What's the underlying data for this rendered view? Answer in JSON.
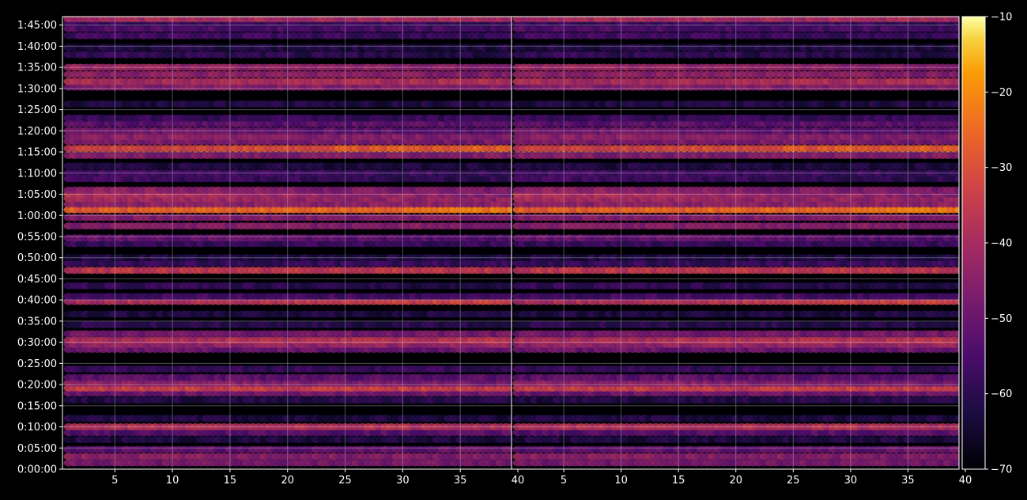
{
  "chart_data": {
    "type": "heatmap",
    "title": "",
    "xlabel": "",
    "ylabel": "",
    "grid": true,
    "panels": [
      {
        "name": "",
        "xlim": [
          1,
          40
        ],
        "xticks": [
          "5",
          "10",
          "15",
          "20",
          "25",
          "30",
          "35",
          "40"
        ],
        "ylim_seconds": [
          0,
          6420
        ]
      },
      {
        "name": "",
        "xlim": [
          1,
          40
        ],
        "xticks": [
          "5",
          "10",
          "15",
          "20",
          "25",
          "30",
          "35",
          "40"
        ],
        "ylim_seconds": [
          0,
          6420
        ]
      }
    ],
    "yticks": [
      {
        "label": "0:00:00",
        "seconds": 0
      },
      {
        "label": "0:05:00",
        "seconds": 300
      },
      {
        "label": "0:10:00",
        "seconds": 600
      },
      {
        "label": "0:15:00",
        "seconds": 900
      },
      {
        "label": "0:20:00",
        "seconds": 1200
      },
      {
        "label": "0:25:00",
        "seconds": 1500
      },
      {
        "label": "0:30:00",
        "seconds": 1800
      },
      {
        "label": "0:35:00",
        "seconds": 2100
      },
      {
        "label": "0:40:00",
        "seconds": 2400
      },
      {
        "label": "0:45:00",
        "seconds": 2700
      },
      {
        "label": "0:50:00",
        "seconds": 3000
      },
      {
        "label": "0:55:00",
        "seconds": 3300
      },
      {
        "label": "1:00:00",
        "seconds": 3600
      },
      {
        "label": "1:05:00",
        "seconds": 3900
      },
      {
        "label": "1:10:00",
        "seconds": 4200
      },
      {
        "label": "1:15:00",
        "seconds": 4500
      },
      {
        "label": "1:20:00",
        "seconds": 4800
      },
      {
        "label": "1:25:00",
        "seconds": 5100
      },
      {
        "label": "1:30:00",
        "seconds": 5400
      },
      {
        "label": "1:35:00",
        "seconds": 5700
      },
      {
        "label": "1:40:00",
        "seconds": 6000
      },
      {
        "label": "1:45:00",
        "seconds": 6300
      }
    ],
    "colorbar": {
      "colormap": "inferno",
      "vmin": -70,
      "vmax": -10,
      "ticks": [
        "−70",
        "−60",
        "−50",
        "−40",
        "−30",
        "−20",
        "−10"
      ]
    },
    "bands": [
      {
        "t": 90,
        "level": -48,
        "trend": 0
      },
      {
        "t": 180,
        "level": -44,
        "trend": -2
      },
      {
        "t": 280,
        "level": -52,
        "trend": 2
      },
      {
        "t": 420,
        "level": -62,
        "trend": 0
      },
      {
        "t": 520,
        "level": -54,
        "trend": 2
      },
      {
        "t": 600,
        "level": -38,
        "trend": 0
      },
      {
        "t": 720,
        "level": -62,
        "trend": 0
      },
      {
        "t": 980,
        "level": -62,
        "trend": 2
      },
      {
        "t": 1080,
        "level": -50,
        "trend": 2
      },
      {
        "t": 1150,
        "level": -34,
        "trend": 0
      },
      {
        "t": 1220,
        "level": -44,
        "trend": -4
      },
      {
        "t": 1300,
        "level": -52,
        "trend": 0
      },
      {
        "t": 1420,
        "level": -58,
        "trend": 0
      },
      {
        "t": 1700,
        "level": -50,
        "trend": 0
      },
      {
        "t": 1770,
        "level": -44,
        "trend": 2
      },
      {
        "t": 1830,
        "level": -40,
        "trend": 4
      },
      {
        "t": 1920,
        "level": -48,
        "trend": 0
      },
      {
        "t": 2050,
        "level": -60,
        "trend": 0
      },
      {
        "t": 2200,
        "level": -62,
        "trend": 0
      },
      {
        "t": 2380,
        "level": -40,
        "trend": 8
      },
      {
        "t": 2450,
        "level": -56,
        "trend": 0
      },
      {
        "t": 2600,
        "level": -58,
        "trend": -4
      },
      {
        "t": 2820,
        "level": -36,
        "trend": 0
      },
      {
        "t": 2920,
        "level": -58,
        "trend": 0
      },
      {
        "t": 3000,
        "level": -62,
        "trend": 0
      },
      {
        "t": 3200,
        "level": -58,
        "trend": 0
      },
      {
        "t": 3280,
        "level": -50,
        "trend": -4
      },
      {
        "t": 3450,
        "level": -46,
        "trend": 0
      },
      {
        "t": 3570,
        "level": -46,
        "trend": 0
      },
      {
        "t": 3680,
        "level": -28,
        "trend": 6
      },
      {
        "t": 3760,
        "level": -44,
        "trend": 0
      },
      {
        "t": 3840,
        "level": -40,
        "trend": -4
      },
      {
        "t": 3900,
        "level": -38,
        "trend": -8
      },
      {
        "t": 3960,
        "level": -44,
        "trend": -4
      },
      {
        "t": 4120,
        "level": -56,
        "trend": -4
      },
      {
        "t": 4200,
        "level": -56,
        "trend": -2
      },
      {
        "t": 4300,
        "level": -62,
        "trend": 0
      },
      {
        "t": 4450,
        "level": -46,
        "trend": 0
      },
      {
        "t": 4550,
        "level": -34,
        "trend": 8
      },
      {
        "t": 4650,
        "level": -46,
        "trend": -2
      },
      {
        "t": 4720,
        "level": -44,
        "trend": -2
      },
      {
        "t": 4800,
        "level": -48,
        "trend": -6
      },
      {
        "t": 4900,
        "level": -52,
        "trend": 0
      },
      {
        "t": 4980,
        "level": -58,
        "trend": 0
      },
      {
        "t": 5180,
        "level": -62,
        "trend": 0
      },
      {
        "t": 5420,
        "level": -46,
        "trend": 0
      },
      {
        "t": 5500,
        "level": -40,
        "trend": 2
      },
      {
        "t": 5600,
        "level": -44,
        "trend": -2
      },
      {
        "t": 5700,
        "level": -42,
        "trend": -4
      },
      {
        "t": 5880,
        "level": -58,
        "trend": -4
      },
      {
        "t": 5980,
        "level": -62,
        "trend": 0
      },
      {
        "t": 6150,
        "level": -56,
        "trend": -2
      },
      {
        "t": 6250,
        "level": -54,
        "trend": -2
      },
      {
        "t": 6330,
        "level": -58,
        "trend": 0
      },
      {
        "t": 6390,
        "level": -40,
        "trend": 0
      }
    ]
  }
}
